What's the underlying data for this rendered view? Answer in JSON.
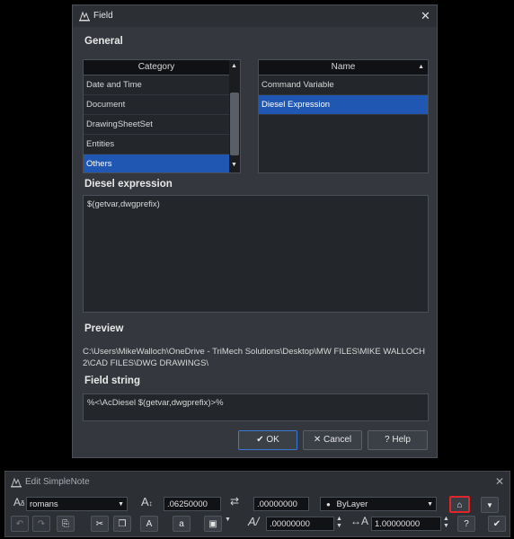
{
  "field_dialog": {
    "title": "Field",
    "close_glyph": "✕",
    "general_label": "General",
    "category_header": "Category",
    "categories": [
      {
        "label": "Date and Time",
        "selected": false
      },
      {
        "label": "Document",
        "selected": false
      },
      {
        "label": "DrawingSheetSet",
        "selected": false
      },
      {
        "label": "Entities",
        "selected": false
      },
      {
        "label": "Others",
        "selected": true
      }
    ],
    "name_header": "Name",
    "names": [
      {
        "label": "Command Variable",
        "selected": false
      },
      {
        "label": "Diesel Expression",
        "selected": true
      }
    ],
    "diesel_label": "Diesel expression",
    "diesel_value": "$(getvar,dwgprefix)",
    "preview_label": "Preview",
    "preview_line1": "C:\\Users\\MikeWalloch\\OneDrive - TriMech Solutions\\Desktop\\MW FILES\\MIKE WALLOCH",
    "preview_line2": "2\\CAD FILES\\DWG DRAWINGS\\",
    "field_string_label": "Field string",
    "field_string_value": "%<\\AcDiesel $(getvar,dwgprefix)>%",
    "ok_label": "OK",
    "cancel_label": "Cancel",
    "help_label": "Help",
    "ok_glyph": "✔",
    "cancel_glyph": "✕",
    "help_glyph": "?"
  },
  "toolbar": {
    "title": "Edit SimpleNote",
    "close_glyph": "✕",
    "font_value": "romans",
    "text_height_value": ".06250000",
    "rotation_value": ".00000000",
    "layer_value": "ByLayer",
    "oblique_value": ".00000000",
    "width_factor_value": "1.00000000",
    "highlight_color": "#e0262b"
  }
}
